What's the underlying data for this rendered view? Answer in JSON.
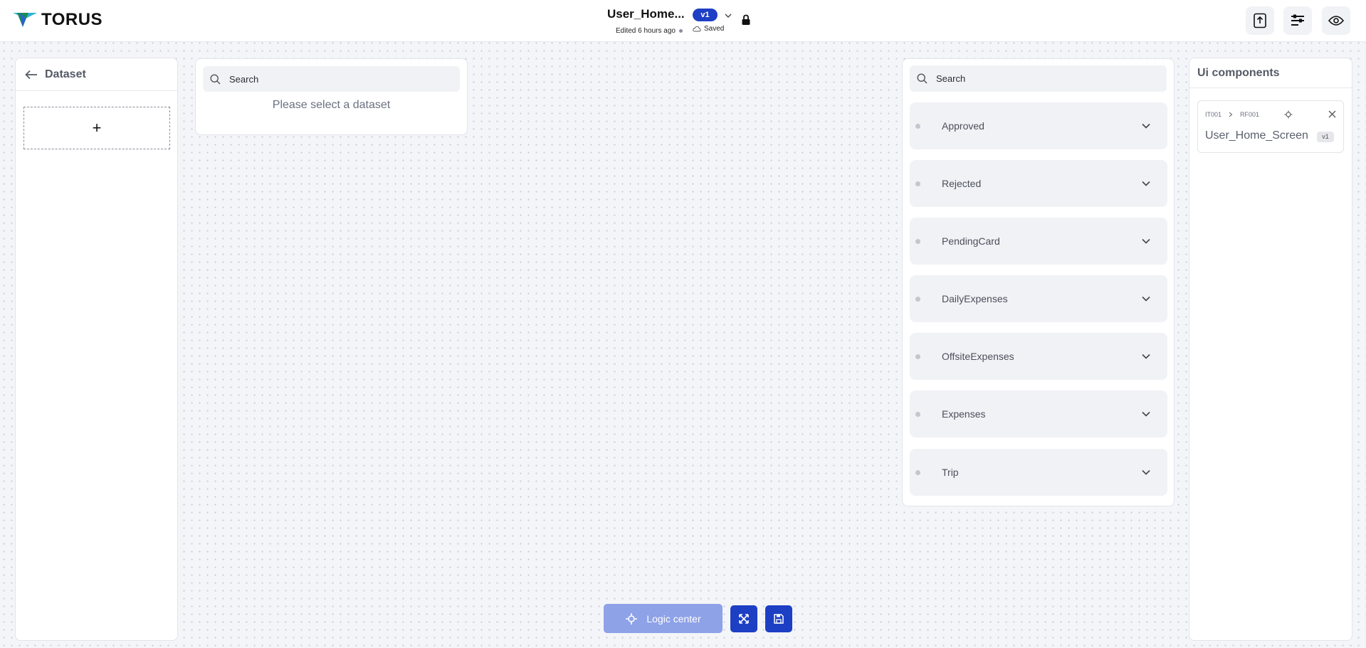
{
  "header": {
    "brand": "TORUS",
    "doc_title": "User_Home...",
    "edited": "Edited 6 hours ago",
    "version": "v1",
    "save_status": "Saved"
  },
  "dataset_panel": {
    "title": "Dataset",
    "add_label": "+"
  },
  "mapping_panel": {
    "search_placeholder": "Search",
    "empty_message": "Please select a dataset"
  },
  "components_list": {
    "search_placeholder": "Search",
    "items": [
      {
        "label": "Approved"
      },
      {
        "label": "Rejected"
      },
      {
        "label": "PendingCard"
      },
      {
        "label": "DailyExpenses"
      },
      {
        "label": "OffsiteExpenses"
      },
      {
        "label": "Expenses"
      },
      {
        "label": "Trip"
      }
    ]
  },
  "ui_panel": {
    "title": "Ui components",
    "card": {
      "crumb_1": "IT001",
      "crumb_2": "RF001",
      "name": "User_Home_Screen",
      "version": "v1"
    }
  },
  "toolbar": {
    "logic_center": "Logic center"
  },
  "colors": {
    "accent": "#1c3fc4",
    "accent_light": "#8ea2e8",
    "canvas": "#f4f5f9"
  }
}
